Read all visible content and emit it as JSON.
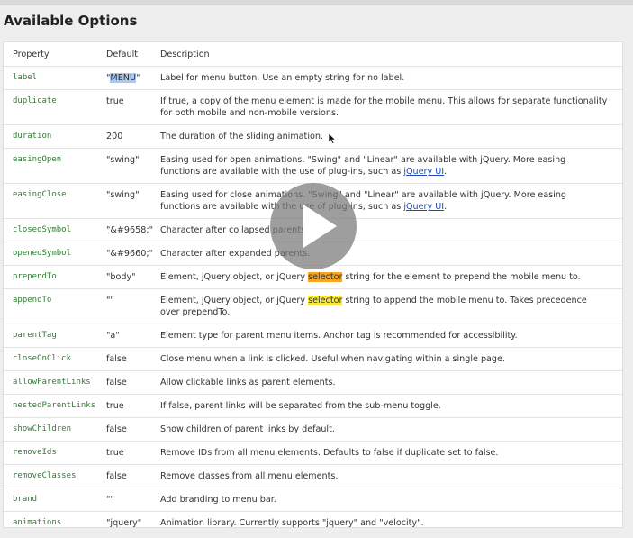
{
  "heading": "Available Options",
  "columns": {
    "property": "Property",
    "default": "Default",
    "description": "Description"
  },
  "rows": [
    {
      "property": "label",
      "default": "\"MENU\"",
      "description": "Label for menu button. Use an empty string for no label."
    },
    {
      "property": "duplicate",
      "default": "true",
      "description": "If true, a copy of the menu element is made for the mobile menu. This allows for separate functionality for both mobile and non-mobile versions."
    },
    {
      "property": "duration",
      "default": "200",
      "description": "The duration of the sliding animation."
    },
    {
      "property": "easingOpen",
      "default": "\"swing\"",
      "description_pre": "Easing used for open animations. \"Swing\" and \"Linear\" are available with jQuery. More easing functions are available with the use of plug-ins, such as ",
      "link": "jQuery UI",
      "description_post": "."
    },
    {
      "property": "easingClose",
      "default": "\"swing\"",
      "description_pre": "Easing used for close animations. \"Swing\" and \"Linear\" are available with jQuery. More easing functions are available with the use of plug-ins, such as ",
      "link": "jQuery UI",
      "description_post": "."
    },
    {
      "property": "closedSymbol",
      "default": "\"&#9658;\"",
      "description": "Character after collapsed parents."
    },
    {
      "property": "openedSymbol",
      "default": "\"&#9660;\"",
      "description": "Character after expanded parents."
    },
    {
      "property": "prependTo",
      "default": "\"body\"",
      "description_pre": "Element, jQuery object, or jQuery ",
      "highlight": "selector",
      "description_post": " string for the element to prepend the mobile menu to."
    },
    {
      "property": "appendTo",
      "default": "\"\"",
      "description_pre": "Element, jQuery object, or jQuery ",
      "highlight": "selector",
      "description_post": " string to append the mobile menu to. Takes precedence over prependTo."
    },
    {
      "property": "parentTag",
      "default": "\"a\"",
      "description": "Element type for parent menu items. Anchor tag is recommended for accessibility."
    },
    {
      "property": "closeOnClick",
      "default": "false",
      "description": "Close menu when a link is clicked. Useful when navigating within a single page."
    },
    {
      "property": "allowParentLinks",
      "default": "false",
      "description": "Allow clickable links as parent elements."
    },
    {
      "property": "nestedParentLinks",
      "default": "true",
      "description": "If false, parent links will be separated from the sub-menu toggle."
    },
    {
      "property": "showChildren",
      "default": "false",
      "description": "Show children of parent links by default."
    },
    {
      "property": "removeIds",
      "default": "true",
      "description": "Remove IDs from all menu elements. Defaults to false if duplicate set to false."
    },
    {
      "property": "removeClasses",
      "default": "false",
      "description": "Remove classes from all menu elements."
    },
    {
      "property": "brand",
      "default": "\"\"",
      "description": "Add branding to menu bar."
    },
    {
      "property": "animations",
      "default": "\"jquery\"",
      "description": "Animation library. Currently supports \"jquery\" and \"velocity\"."
    }
  ],
  "overlay": {
    "icon": "play-icon",
    "cursor": "mouse-cursor"
  },
  "colors": {
    "property_text": "#2e7d32",
    "link": "#1a4bb5",
    "highlight_orange": "#f5a623",
    "highlight_yellow": "#f7ea3c",
    "selection_blue": "#a9c9f5"
  }
}
